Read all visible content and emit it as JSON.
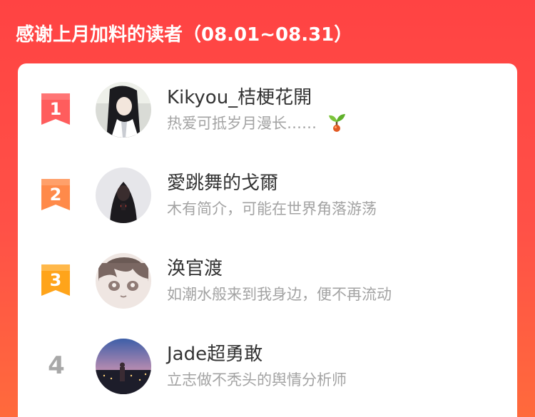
{
  "header": {
    "title": "感谢上月加料的读者（08.01~08.31）"
  },
  "colors": {
    "background_top": "#ff4343",
    "background_bottom": "#ff6a3c",
    "rank1": "#ff5d5d",
    "rank2": "#ff8a4a",
    "rank3": "#ffa41a",
    "rank_plain": "#a8a8a8",
    "name_text": "#333333",
    "bio_text": "#a3a3a3"
  },
  "readers": [
    {
      "rank": "1",
      "rank_style": "ribbon-red",
      "name": "Kikyou_桔梗花開",
      "bio": "热爱可抵岁月漫长……",
      "bio_icon": "sprout-icon",
      "avatar": "avatar-anime-girl"
    },
    {
      "rank": "2",
      "rank_style": "ribbon-orange",
      "name": "愛跳舞的戈爾",
      "bio": "木有简介，可能在世界角落游荡",
      "avatar": "avatar-hooded-figure"
    },
    {
      "rank": "3",
      "rank_style": "ribbon-amber",
      "name": "涣官渡",
      "bio": "如潮水般来到我身边，便不再流动",
      "avatar": "avatar-cartoon-face"
    },
    {
      "rank": "4",
      "rank_style": "plain",
      "name": "Jade超勇敢",
      "bio": "立志做不秃头的舆情分析师",
      "avatar": "avatar-night-city"
    }
  ]
}
